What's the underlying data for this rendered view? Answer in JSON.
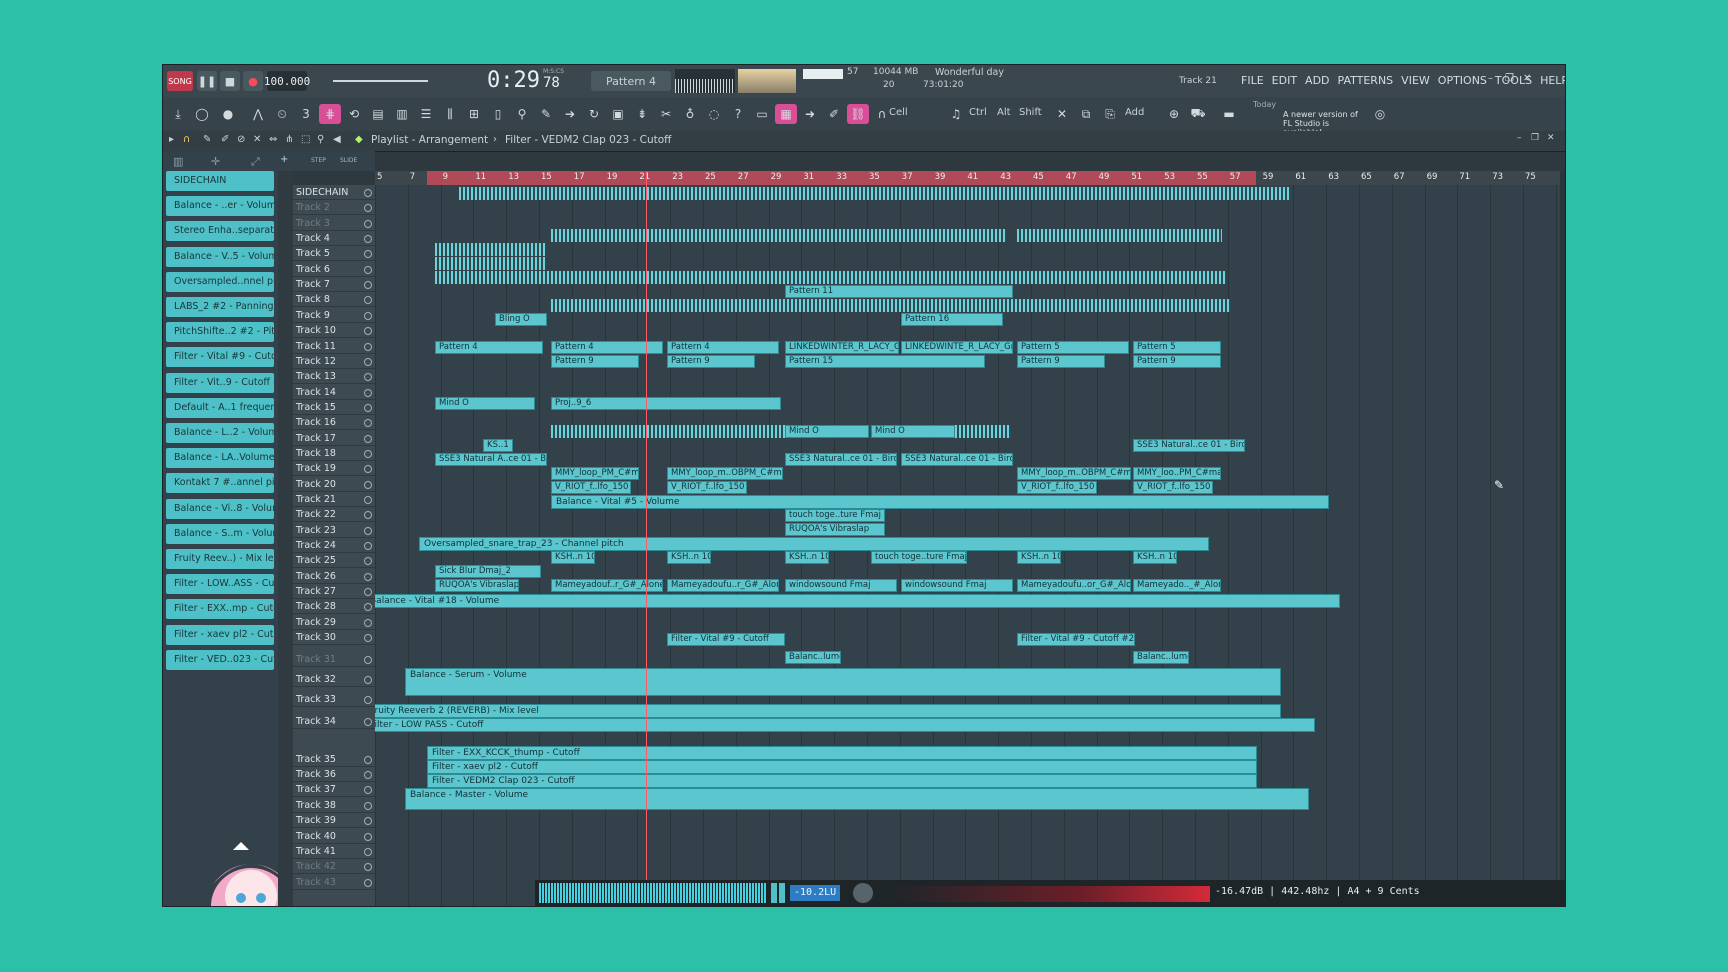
{
  "topbar": {
    "mode_label": "SONG",
    "tempo": "100.000",
    "time": "0:29",
    "time_frac": "78",
    "time_unit": "M:S:CS",
    "pattern": "Pattern 4",
    "cpu_value": "57",
    "memory": "10044 MB",
    "voices": "20",
    "hint_title": "Wonderful day",
    "hint_time": "73:01:20",
    "track_label": "Track 21",
    "menu": [
      "FILE",
      "EDIT",
      "ADD",
      "PATTERNS",
      "VIEW",
      "OPTIONS",
      "TOOLS",
      "HELP"
    ]
  },
  "toolbar": {
    "snap": "Cell",
    "keys": [
      "Ctrl",
      "Alt",
      "Shift"
    ],
    "add_label": "Add",
    "news_today": "Today",
    "news_text": "A newer version of FL Studio is available!"
  },
  "playlist": {
    "breadcrumb": [
      "Playlist - Arrangement",
      "Filter - VEDM2 Clap 023 - Cutoff"
    ],
    "step_label": "STEP",
    "slide_label": "SLIDE"
  },
  "channels": [
    "SIDECHAIN",
    "Balance - ..er - Volume",
    "Stereo Enha..separation",
    "Balance - V..5 - Volume",
    "Oversampled..nnel pitch",
    "LABS_2 #2 - Panning",
    "PitchShifte..2 #2 - Pitch",
    "Filter - Vital #9 - Cutoff",
    "Filter - Vit..9 - Cutoff #2",
    "Default - A..1 frequency",
    "Balance - L..2 - Volume",
    "Balance - LA..Volume #2",
    "Kontakt 7 #..annel pitch",
    "Balance - Vi..8 - Volume",
    "Balance - S..m - Volume",
    "Fruity Reev..) - Mix leve",
    "Filter - LOW..ASS - Cutof",
    "Filter - EXX..mp - Cutof",
    "Filter - xaev pl2 - Cutof",
    "Filter - VED..023 - Cutoff"
  ],
  "tracks": [
    "SIDECHAIN",
    "Track 2",
    "Track 3",
    "Track 4",
    "Track 5",
    "Track 6",
    "Track 7",
    "Track 8",
    "Track 9",
    "Track 10",
    "Track 11",
    "Track 12",
    "Track 13",
    "Track 14",
    "Track 15",
    "Track 16",
    "Track 17",
    "Track 18",
    "Track 19",
    "Track 20",
    "Track 21",
    "Track 22",
    "Track 23",
    "Track 24",
    "Track 25",
    "Track 26",
    "Track 27",
    "Track 28",
    "Track 29",
    "Track 30",
    "Track 31",
    "Track 32",
    "Track 33",
    "Track 34",
    "Track 35",
    "Track 36",
    "Track 37",
    "Track 38",
    "Track 39",
    "Track 40",
    "Track 41",
    "Track 42",
    "Track 43"
  ],
  "ruler_ticks": [
    "5",
    "7",
    "9",
    "11",
    "13",
    "15",
    "17",
    "19",
    "21",
    "23",
    "25",
    "27",
    "29",
    "31",
    "33",
    "35",
    "37",
    "39",
    "41",
    "43",
    "45",
    "47",
    "49",
    "51",
    "53",
    "55",
    "57",
    "59",
    "61",
    "63",
    "65",
    "67",
    "69",
    "71",
    "73",
    "75"
  ],
  "clips": {
    "pattern_11": "Pattern 11",
    "pattern_16": "Pattern 16",
    "pattern_4a": "Pattern 4",
    "pattern_4b": "Pattern 4",
    "pattern_4c": "Pattern 4",
    "linked_a": "LINKEDWINTER_R_LACY_Gmaj",
    "linked_b": "LINKEDWINTE_R_LACY_Gmaj",
    "pattern_5a": "Pattern 5",
    "pattern_5b": "Pattern 5",
    "pattern_9a": "Pattern 9",
    "pattern_9b": "Pattern 9",
    "pattern_9c": "Pattern 9",
    "pattern_9d": "Pattern 9",
    "pattern_15": "Pattern 15",
    "bling": "Bling O",
    "mind_a": "Mind O",
    "mind_b": "Mind O",
    "mind_c": "Mind O",
    "proj": "Proj..9_6",
    "ks": "KS..1",
    "sse_a": "SSE3 Natural A..ce 01 - Birds",
    "sse_b": "SSE3 Natural..ce 01 - Birds",
    "sse_c": "SSE3 Natural..ce 01 - Birds",
    "sse_d": "SSE3 Natural..ce 01 - Birds",
    "mmy_a": "MMY_loop_PM_C#maj",
    "mmy_b": "MMY_loop_m..OBPM_C#maj",
    "mmy_c": "MMY_loop_m..OBPM_C#maj",
    "mmy_d": "MMY_loo..PM_C#maj",
    "vriot_a": "V_RIOT_f..lfo_150",
    "vriot_b": "V_RIOT_f..lfo_150",
    "vriot_c": "V_RIOT_f..lfo_150",
    "vriot_d": "V_RIOT_f..lfo_150",
    "balance_vital5": "Balance - Vital #5 - Volume",
    "touch_a": "touch toge..ture Fmaj",
    "touch_b": "touch toge..ture Fmaj",
    "rugoa": "RUQOA's Vibraslap",
    "rugoa_b": "RUQOA's Vibraslap",
    "oversampled": "Oversampled_snare_trap_23 - Channel pitch",
    "ksh_a": "KSH..n 10",
    "ksh_b": "KSH..n 10",
    "ksh_c": "KSH..n 10",
    "ksh_d": "KSH..n 10",
    "ksh_e": "KSH..n 10",
    "sick_blur": "Sick Blur Dmaj_2",
    "mame_a": "Mameyadouf..r_G#_Alone",
    "mame_b": "Mameyadoufu..r_G#_Alone",
    "mame_c": "Mameyadoufu..or_G#_Alone",
    "mame_d": "Mameyado.._#_Alone",
    "wind_a": "windowsound Fmaj",
    "wind_b": "windowsound Fmaj",
    "bal_vital18": "Balance - Vital #18 - Volume",
    "filter_vital9": "Filter - Vital #9 - Cutoff",
    "filter_vital9b": "Filter - Vital #9 - Cutoff #2",
    "balance_lume": "Balanc..lume",
    "balance_serum": "Balance - Serum - Volume",
    "fruity_reeverb": "Fruity Reeverb 2 (REVERB) - Mix level",
    "filter_lowpass": "Filter - LOW PASS - Cutoff",
    "filter_exx": "Filter - EXX_KCCK_thump - Cutoff",
    "filter_xaev": "Filter - xaev pl2 - Cutoff",
    "filter_vedm2": "Filter - VEDM2 Clap 023 - Cutoff",
    "balance_master": "Balance - Master - Volume"
  },
  "bottombar": {
    "level": "-10.2LU",
    "readout": "-16.47dB | 442.48hz | A4 + 9 Cents"
  },
  "colors": {
    "background": "#2cc0a8",
    "clip": "#5cc6cf",
    "loop_region": "#b04a58",
    "playhead": "#ff5a6a"
  }
}
